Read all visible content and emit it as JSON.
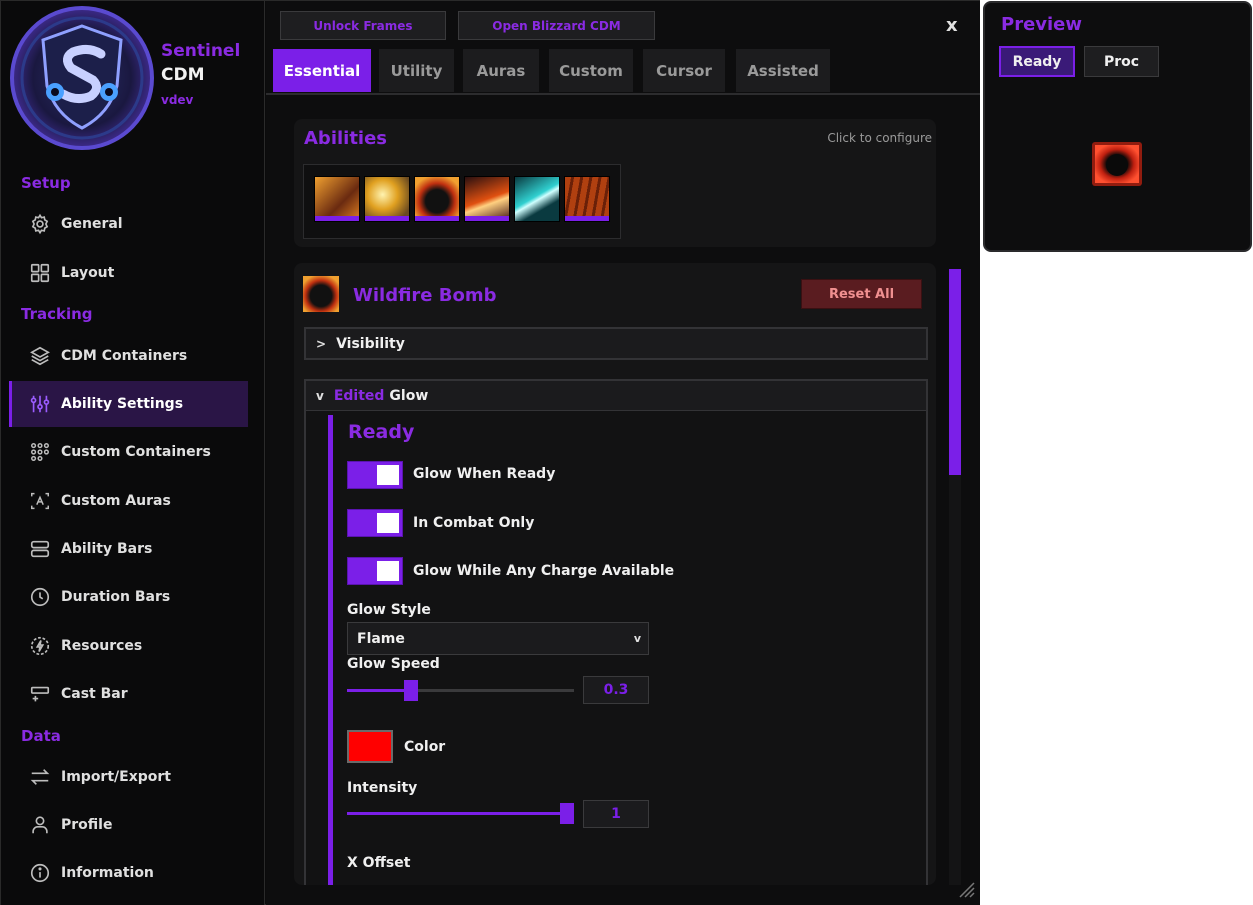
{
  "brand": {
    "name": "Sentinel",
    "sub": "CDM",
    "version": "vdev"
  },
  "sidebar": {
    "sections": [
      {
        "title": "Setup",
        "items": [
          {
            "label": "General",
            "icon": "gear-icon"
          },
          {
            "label": "Layout",
            "icon": "grid-icon"
          }
        ]
      },
      {
        "title": "Tracking",
        "items": [
          {
            "label": "CDM Containers",
            "icon": "layers-icon"
          },
          {
            "label": "Ability Settings",
            "icon": "sliders-icon",
            "active": true
          },
          {
            "label": "Custom Containers",
            "icon": "dots-grid-icon"
          },
          {
            "label": "Custom Auras",
            "icon": "aura-icon"
          },
          {
            "label": "Ability Bars",
            "icon": "bars-icon"
          },
          {
            "label": "Duration Bars",
            "icon": "clock-icon"
          },
          {
            "label": "Resources",
            "icon": "bolt-icon"
          },
          {
            "label": "Cast Bar",
            "icon": "cast-bar-icon"
          }
        ]
      },
      {
        "title": "Data",
        "items": [
          {
            "label": "Import/Export",
            "icon": "swap-icon"
          },
          {
            "label": "Profile",
            "icon": "user-icon"
          },
          {
            "label": "Information",
            "icon": "info-icon"
          }
        ]
      }
    ]
  },
  "toolbar": {
    "unlock_label": "Unlock Frames",
    "blizzard_label": "Open Blizzard CDM",
    "close_label": "x"
  },
  "tabs": [
    "Essential",
    "Utility",
    "Auras",
    "Custom",
    "Cursor",
    "Assisted"
  ],
  "active_tab": "Essential",
  "abilities": {
    "title": "Abilities",
    "hint": "Click to configure",
    "count": 6
  },
  "detail": {
    "title": "Wildfire Bomb",
    "reset_label": "Reset All",
    "visibility": {
      "chev": ">",
      "label": "Visibility"
    },
    "glow": {
      "chev": "v",
      "edited": "Edited",
      "label": "Glow"
    },
    "ready": {
      "title": "Ready",
      "toggles": [
        {
          "label": "Glow When Ready",
          "on": true
        },
        {
          "label": "In Combat Only",
          "on": true
        },
        {
          "label": "Glow While Any Charge Available",
          "on": true
        }
      ],
      "glow_style_label": "Glow Style",
      "glow_style_value": "Flame",
      "glow_style_arrow": "v",
      "glow_speed_label": "Glow Speed",
      "glow_speed_value": "0.3",
      "glow_speed_fraction": 0.28,
      "color_label": "Color",
      "color_value": "#ff0000",
      "intensity_label": "Intensity",
      "intensity_value": "1",
      "intensity_fraction": 1.0,
      "x_offset_label": "X Offset"
    }
  },
  "preview": {
    "title": "Preview",
    "ready_label": "Ready",
    "proc_label": "Proc"
  },
  "colors": {
    "accent": "#7b1fe8",
    "accent_text": "#8a2be2",
    "reset_bg": "#5a1c20"
  }
}
